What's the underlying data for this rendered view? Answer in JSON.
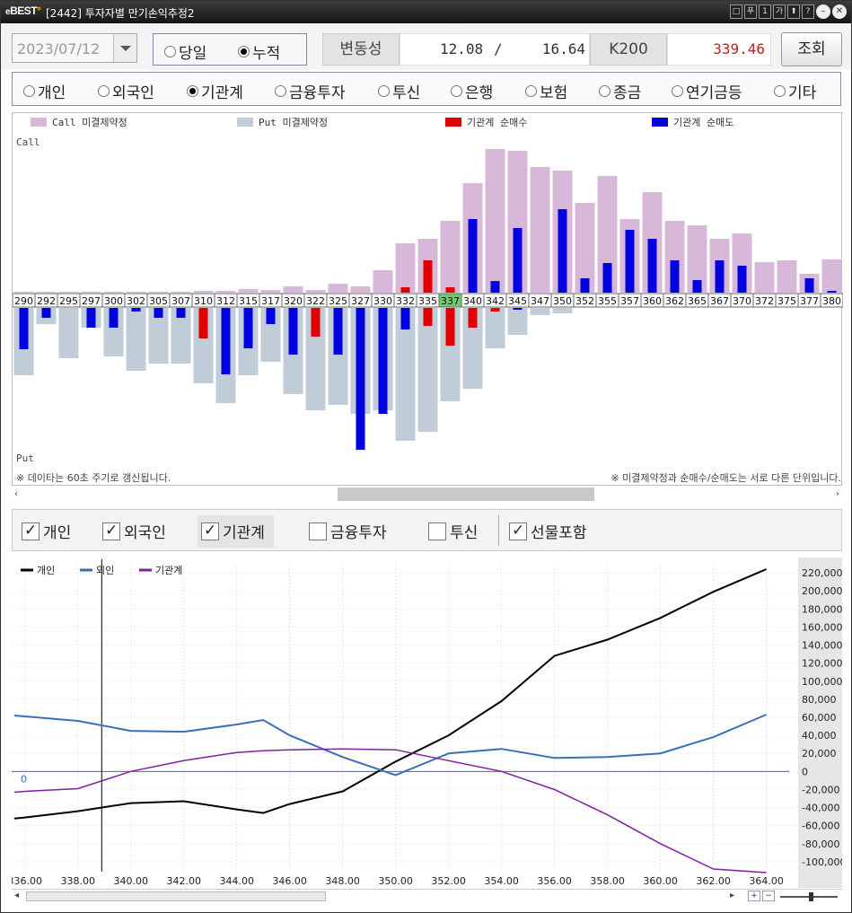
{
  "window": {
    "brand": "BEST",
    "title": "[2442] 투자자별 만기손익추정2",
    "buttons": [
      "□",
      "푸",
      "1",
      "가",
      "⬆",
      "?"
    ]
  },
  "controls": {
    "date": "2023/07/12",
    "modes": [
      {
        "label": "당일",
        "selected": false
      },
      {
        "label": "누적",
        "selected": true
      }
    ],
    "volatility_label": "변동성",
    "volatility_value_1": "12.08",
    "volatility_sep": "/",
    "volatility_value_2": "16.64",
    "index_label": "K200",
    "index_value": "339.46",
    "query_label": "조회"
  },
  "investors": [
    {
      "label": "개인",
      "selected": false
    },
    {
      "label": "외국인",
      "selected": false
    },
    {
      "label": "기관계",
      "selected": true
    },
    {
      "label": "금융투자",
      "selected": false
    },
    {
      "label": "투신",
      "selected": false
    },
    {
      "label": "은행",
      "selected": false
    },
    {
      "label": "보험",
      "selected": false
    },
    {
      "label": "종금",
      "selected": false
    },
    {
      "label": "연기금등",
      "selected": false
    },
    {
      "label": "기타",
      "selected": false
    }
  ],
  "chart_data": [
    {
      "type": "bar",
      "legend": [
        "Call 미결제약정",
        "Put 미결제약정",
        "기관계 순매수",
        "기관계 순매도"
      ],
      "colors": {
        "call_oi": "#d8b8d8",
        "put_oi": "#c0ccd8",
        "net_buy": "#e00000",
        "net_sell": "#0000e0",
        "highlight": "#70c870"
      },
      "upper_label": "Call",
      "lower_label": "Put",
      "highlight_strike": "337",
      "strikes": [
        "290",
        "292",
        "295",
        "297",
        "300",
        "302",
        "305",
        "307",
        "310",
        "312",
        "315",
        "317",
        "320",
        "322",
        "325",
        "327",
        "330",
        "332",
        "335",
        "337",
        "340",
        "342",
        "345",
        "347",
        "350",
        "352",
        "355",
        "357",
        "360",
        "362",
        "365",
        "367",
        "370",
        "372",
        "375",
        "377",
        "380"
      ],
      "call_oi": [
        1,
        1,
        1,
        1,
        1,
        1,
        1,
        1,
        2,
        2,
        4,
        3,
        7,
        3,
        10,
        7,
        25,
        55,
        60,
        80,
        122,
        160,
        158,
        140,
        136,
        100,
        130,
        82,
        112,
        80,
        75,
        60,
        66,
        34,
        36,
        21,
        37
      ],
      "call_net": [
        0,
        0,
        0,
        0,
        0,
        0,
        0,
        0,
        0,
        0,
        0,
        0,
        0,
        0,
        0,
        0,
        0,
        -6,
        -36,
        -6,
        82,
        13,
        72,
        0,
        93,
        16,
        33,
        70,
        60,
        36,
        14,
        36,
        30,
        0,
        0,
        16,
        2
      ],
      "put_oi": [
        75,
        18,
        56,
        22,
        54,
        70,
        62,
        62,
        84,
        106,
        75,
        60,
        96,
        114,
        108,
        118,
        114,
        148,
        138,
        104,
        90,
        45,
        30,
        8,
        6,
        0,
        0,
        0,
        0,
        0,
        0,
        0,
        0,
        0,
        0,
        0,
        0
      ],
      "put_net": [
        46,
        11,
        0,
        22,
        22,
        4,
        11,
        11,
        -34,
        74,
        45,
        18,
        52,
        -32,
        52,
        158,
        118,
        24,
        -20,
        -42,
        -22,
        -4,
        2,
        0,
        0,
        0,
        0,
        0,
        0,
        0,
        0,
        0,
        0,
        0,
        0,
        0,
        0
      ],
      "footnote_left": "※ 데이타는 60초 주기로 갱신됩니다.",
      "footnote_right": "※ 미결제약정과 순매수/순매도는 서로 다른 단위입니다."
    },
    {
      "type": "line",
      "x": [
        335.6,
        336,
        338,
        340,
        342,
        344,
        345,
        346,
        348,
        350,
        352,
        354,
        356,
        358,
        360,
        362,
        364
      ],
      "xticks": [
        "336.00",
        "338.00",
        "340.00",
        "342.00",
        "344.00",
        "346.00",
        "348.00",
        "350.00",
        "352.00",
        "354.00",
        "356.00",
        "358.00",
        "360.00",
        "362.00",
        "364.00"
      ],
      "xlim": [
        335.5,
        365.2
      ],
      "yticks": [
        "220,000",
        "200,000",
        "180,000",
        "160,000",
        "140,000",
        "120,000",
        "100,000",
        "80,000",
        "60,000",
        "40,000",
        "20,000",
        "0",
        "-20,000",
        "-40,000",
        "-60,000",
        "-80,000",
        "-100,000"
      ],
      "ylim": [
        -111000,
        229000
      ],
      "zero_label": "0",
      "cursor_x": 338.9,
      "series": [
        {
          "name": "개인",
          "color": "#000000",
          "values": [
            -52000,
            -51000,
            -44000,
            -35000,
            -33000,
            -42000,
            -46000,
            -36000,
            -22000,
            11000,
            40000,
            78000,
            128000,
            146000,
            170000,
            199000,
            224000
          ]
        },
        {
          "name": "외인",
          "color": "#3a6fb8",
          "values": [
            62000,
            61000,
            56000,
            45000,
            44000,
            52000,
            57000,
            40000,
            16000,
            -4000,
            20000,
            25000,
            15000,
            16000,
            20000,
            38000,
            63000
          ]
        },
        {
          "name": "기관계",
          "color": "#8020a0",
          "values": [
            -23000,
            -22000,
            -19000,
            0,
            12000,
            21000,
            23000,
            24000,
            25000,
            24000,
            12000,
            0,
            -20000,
            -48000,
            -80000,
            -108000,
            -112000
          ]
        }
      ]
    }
  ],
  "bottom_filters": [
    {
      "label": "개인",
      "checked": true
    },
    {
      "label": "외국인",
      "checked": true
    },
    {
      "label": "기관계",
      "checked": true
    },
    {
      "label": "금융투자",
      "checked": false
    },
    {
      "label": "투신",
      "checked": false
    },
    {
      "label": "선물포함",
      "checked": true
    }
  ]
}
